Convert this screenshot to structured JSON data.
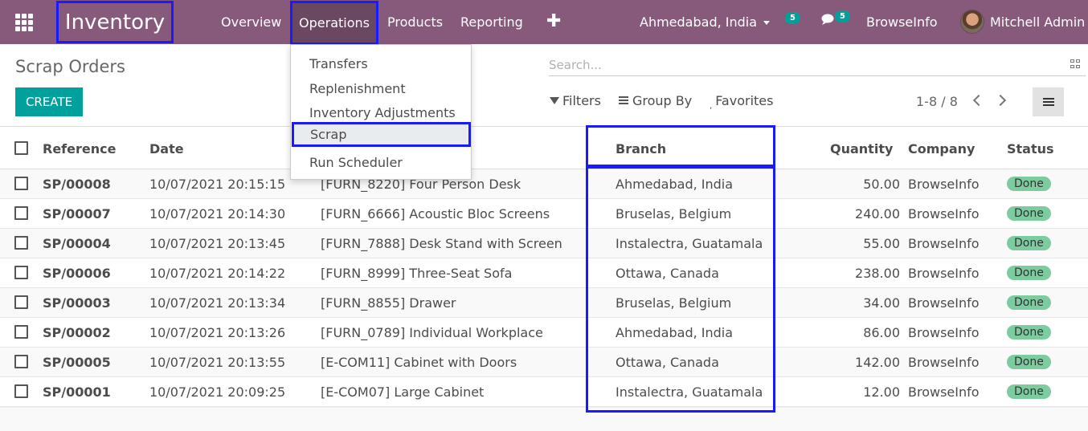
{
  "navbar": {
    "app_title": "Inventory",
    "menu": [
      "Overview",
      "Operations",
      "Products",
      "Reporting"
    ],
    "active_menu": "Operations",
    "branch_selector": "Ahmedabad, India",
    "activity_count": "5",
    "message_count": "5",
    "company": "BrowseInfo",
    "user": "Mitchell Admin",
    "color": "#875a7b"
  },
  "operations_menu": {
    "items": [
      "Transfers",
      "Replenishment",
      "Inventory Adjustments",
      "Scrap",
      "Run Scheduler"
    ],
    "selected": "Scrap"
  },
  "control_panel": {
    "breadcrumb": "Scrap Orders",
    "create_label": "CREATE",
    "search_placeholder": "Search...",
    "filters_label": "Filters",
    "groupby_label": "Group By",
    "favorites_label": "Favorites",
    "pager": "1-8 / 8",
    "accent": "#00a09d"
  },
  "table": {
    "headers": [
      "Reference",
      "Date",
      "Branch",
      "Quantity",
      "Company",
      "Status"
    ],
    "rows": [
      {
        "ref": "SP/00008",
        "date": "10/07/2021 20:15:15",
        "product": "[FURN_8220] Four Person Desk",
        "branch": "Ahmedabad, India",
        "qty": "50.00",
        "company": "BrowseInfo",
        "status": "Done"
      },
      {
        "ref": "SP/00007",
        "date": "10/07/2021 20:14:30",
        "product": "[FURN_6666] Acoustic Bloc Screens",
        "branch": "Bruselas, Belgium",
        "qty": "240.00",
        "company": "BrowseInfo",
        "status": "Done"
      },
      {
        "ref": "SP/00004",
        "date": "10/07/2021 20:13:45",
        "product": "[FURN_7888] Desk Stand with Screen",
        "branch": "Instalectra, Guatamala",
        "qty": "55.00",
        "company": "BrowseInfo",
        "status": "Done"
      },
      {
        "ref": "SP/00006",
        "date": "10/07/2021 20:14:22",
        "product": "[FURN_8999] Three-Seat Sofa",
        "branch": "Ottawa, Canada",
        "qty": "238.00",
        "company": "BrowseInfo",
        "status": "Done"
      },
      {
        "ref": "SP/00003",
        "date": "10/07/2021 20:13:34",
        "product": "[FURN_8855] Drawer",
        "branch": "Bruselas, Belgium",
        "qty": "34.00",
        "company": "BrowseInfo",
        "status": "Done"
      },
      {
        "ref": "SP/00002",
        "date": "10/07/2021 20:13:26",
        "product": "[FURN_0789] Individual Workplace",
        "branch": "Ahmedabad, India",
        "qty": "86.00",
        "company": "BrowseInfo",
        "status": "Done"
      },
      {
        "ref": "SP/00005",
        "date": "10/07/2021 20:13:55",
        "product": "[E-COM11] Cabinet with Doors",
        "branch": "Ottawa, Canada",
        "qty": "142.00",
        "company": "BrowseInfo",
        "status": "Done"
      },
      {
        "ref": "SP/00001",
        "date": "10/07/2021 20:09:25",
        "product": "[E-COM07] Large Cabinet",
        "branch": "Instalectra, Guatamala",
        "qty": "12.00",
        "company": "BrowseInfo",
        "status": "Done"
      }
    ],
    "status_color": "#7ccc9f",
    "highlight_color": "#1a1aff"
  }
}
